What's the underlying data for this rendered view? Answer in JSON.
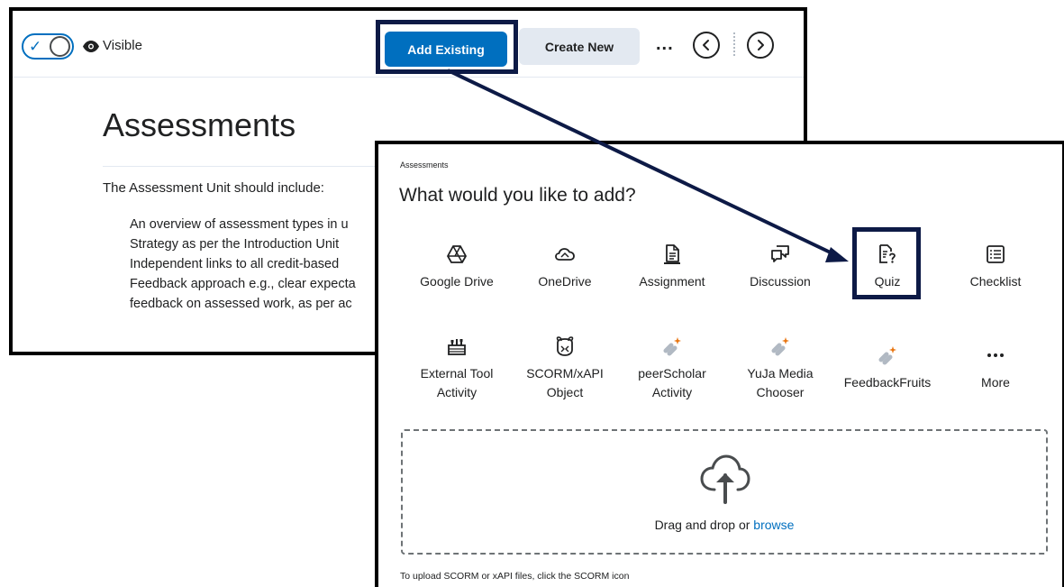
{
  "editor": {
    "visibility_label": "Visible",
    "add_existing_label": "Add Existing",
    "create_new_label": "Create New",
    "more_label": "...",
    "page_title": "Assessments",
    "intro": "The Assessment Unit should include:",
    "bullets": [
      "An overview of assessment types in u",
      "Strategy as per the Introduction Unit",
      "Independent links to all credit-based",
      "Feedback approach e.g., clear expecta",
      "feedback on assessed work, as per ac"
    ]
  },
  "dialog": {
    "breadcrumb": "Assessments",
    "title": "What would you like to add?",
    "tiles_row1": [
      {
        "label": "Google Drive",
        "icon": "google-drive-icon"
      },
      {
        "label": "OneDrive",
        "icon": "onedrive-icon"
      },
      {
        "label": "Assignment",
        "icon": "assignment-icon"
      },
      {
        "label": "Discussion",
        "icon": "discussion-icon"
      },
      {
        "label": "Quiz",
        "icon": "quiz-icon"
      },
      {
        "label": "Checklist",
        "icon": "checklist-icon"
      }
    ],
    "tiles_row2": [
      {
        "label_line1": "External Tool",
        "label_line2": "Activity",
        "icon": "external-tool-icon"
      },
      {
        "label_line1": "SCORM/xAPI",
        "label_line2": "Object",
        "icon": "scorm-icon"
      },
      {
        "label_line1": "peerScholar",
        "label_line2": "Activity",
        "icon": "link-plugin-icon"
      },
      {
        "label_line1": "YuJa Media",
        "label_line2": "Chooser",
        "icon": "link-plugin-icon"
      },
      {
        "label_line1": "FeedbackFruits",
        "label_line2": "",
        "icon": "link-plugin-icon"
      },
      {
        "label_line1": "More",
        "label_line2": "",
        "icon": "more-icon"
      }
    ],
    "drop_text": "Drag and drop or",
    "browse_label": "browse",
    "scorm_note": "To upload SCORM or xAPI files, click the SCORM icon"
  },
  "colors": {
    "primary": "#006fbf",
    "highlight_border": "#0d1a46",
    "plugin_orange": "#e87511"
  }
}
